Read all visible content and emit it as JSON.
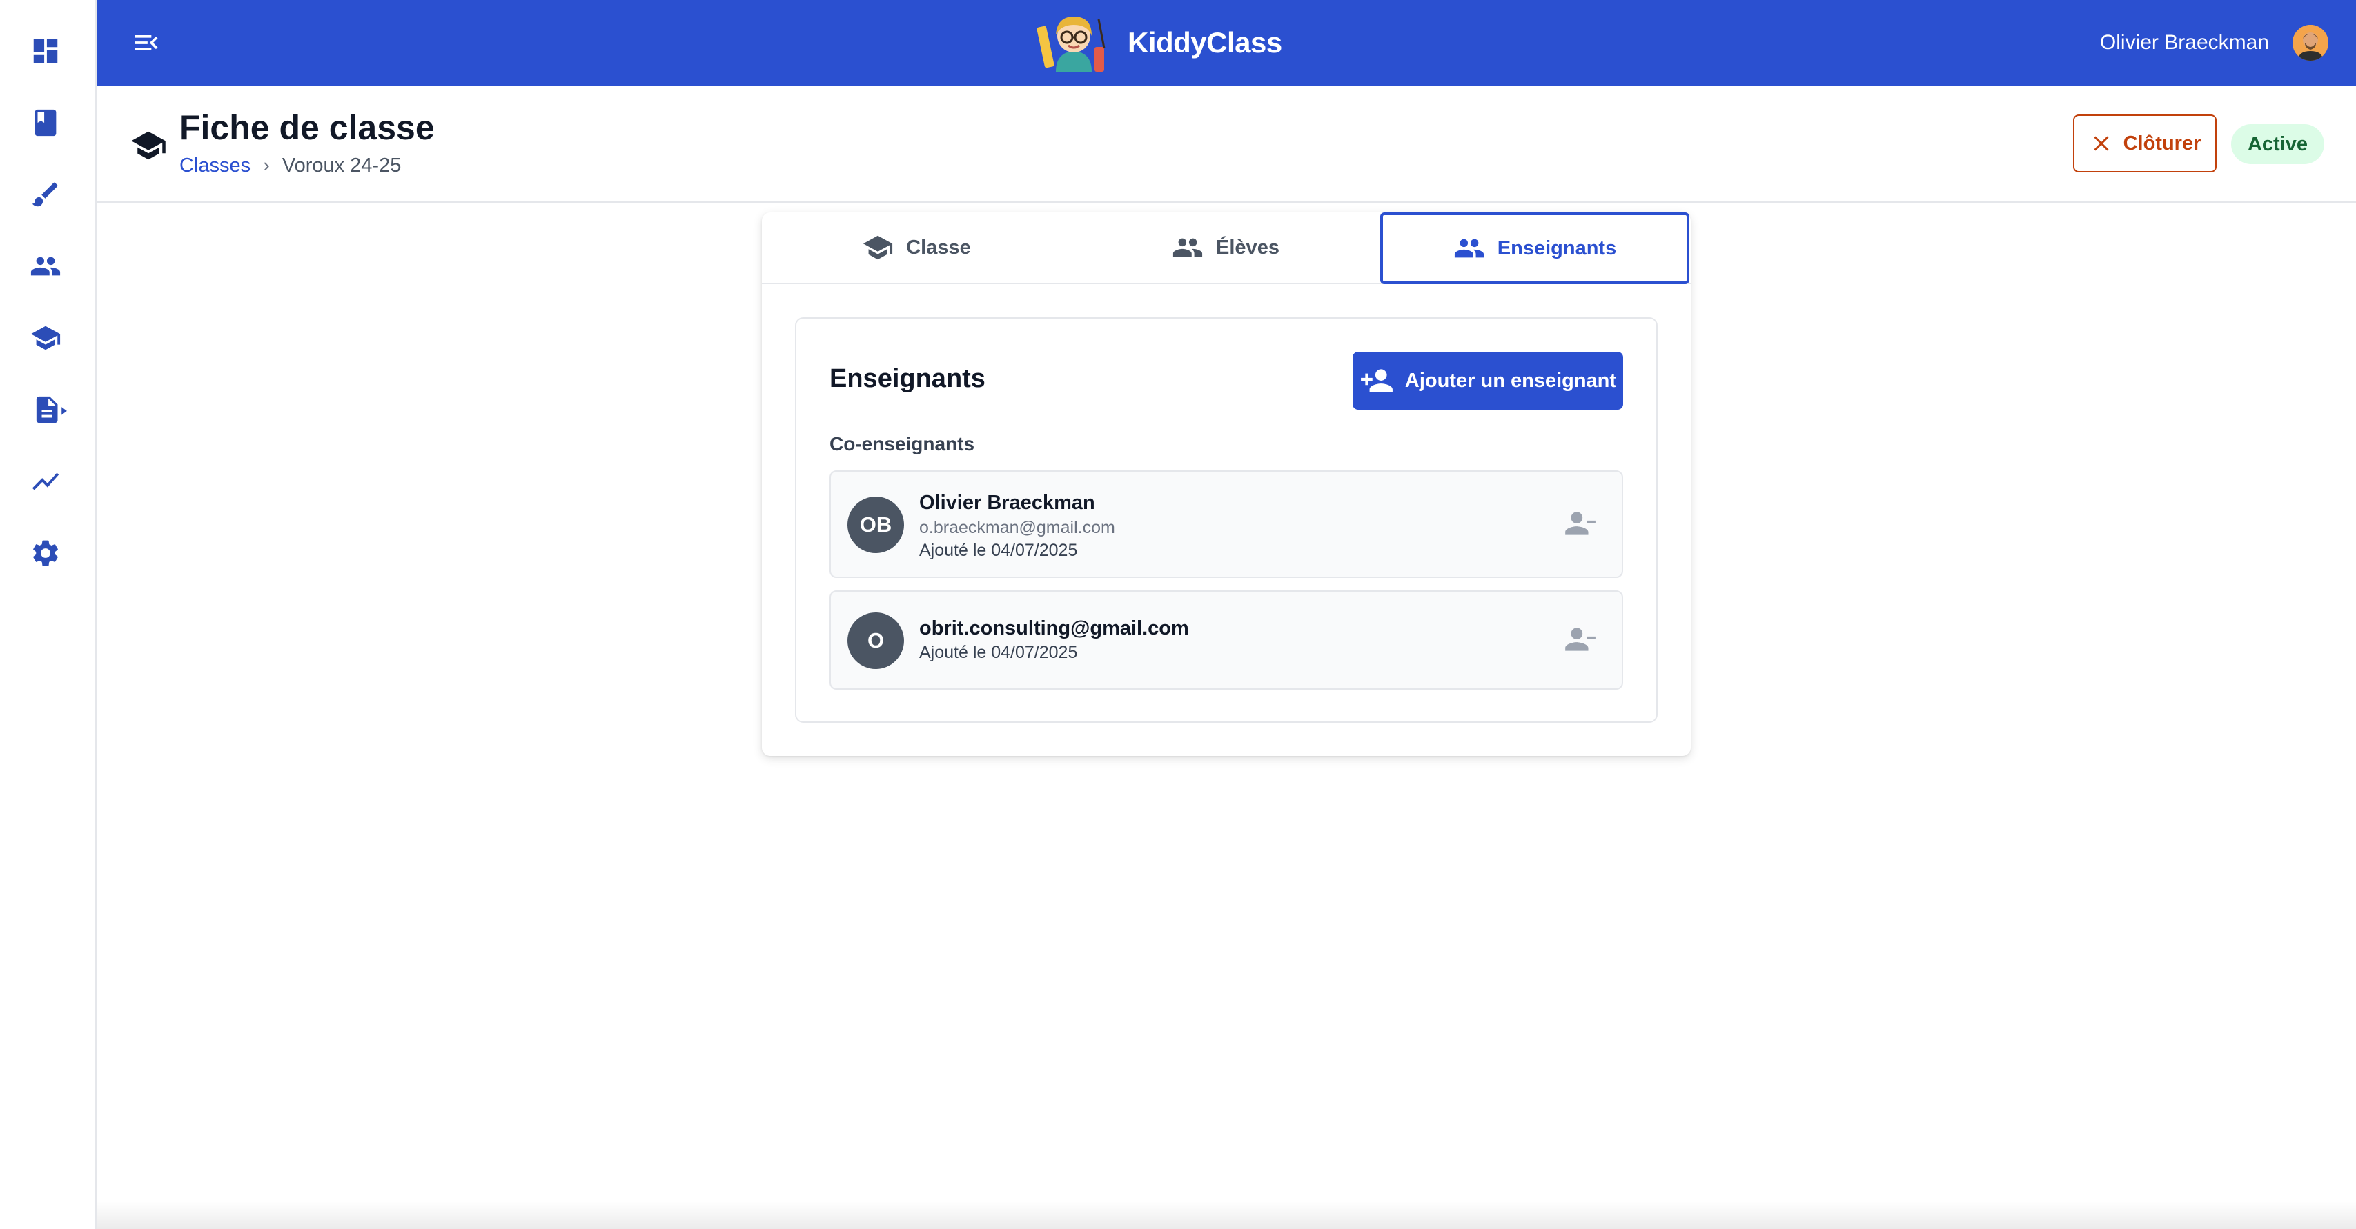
{
  "sidebar": {
    "items": [
      {
        "icon": "dashboard-icon",
        "name": "sidebar-item-dashboard"
      },
      {
        "icon": "book-icon",
        "name": "sidebar-item-book"
      },
      {
        "icon": "brush-icon",
        "name": "sidebar-item-brush"
      },
      {
        "icon": "people-icon",
        "name": "sidebar-item-people"
      },
      {
        "icon": "school-icon",
        "name": "sidebar-item-school"
      },
      {
        "icon": "document-play-icon",
        "name": "sidebar-item-documents"
      },
      {
        "icon": "trending-icon",
        "name": "sidebar-item-stats"
      },
      {
        "icon": "gear-icon",
        "name": "sidebar-item-settings"
      }
    ]
  },
  "topbar": {
    "app_name": "KiddyClass",
    "user_name": "Olivier Braeckman",
    "background_color": "#2b50d0"
  },
  "header": {
    "title": "Fiche de classe",
    "breadcrumb": {
      "link": "Classes",
      "separator": "›",
      "current": "Voroux 24-25"
    },
    "close_label": "Clôturer",
    "status": "Active"
  },
  "tabs": [
    {
      "label": "Classe",
      "icon": "school-icon",
      "active": false
    },
    {
      "label": "Élèves",
      "icon": "people-icon",
      "active": false
    },
    {
      "label": "Enseignants",
      "icon": "people-icon",
      "active": true
    }
  ],
  "panel": {
    "title": "Enseignants",
    "add_label": "Ajouter un enseignant",
    "section_label": "Co-enseignants",
    "teachers": [
      {
        "initials": "OB",
        "name": "Olivier Braeckman",
        "email": "o.braeckman@gmail.com",
        "added": "Ajouté le 04/07/2025"
      },
      {
        "initials": "O",
        "name": "obrit.consulting@gmail.com",
        "added": "Ajouté le 04/07/2025"
      }
    ]
  }
}
